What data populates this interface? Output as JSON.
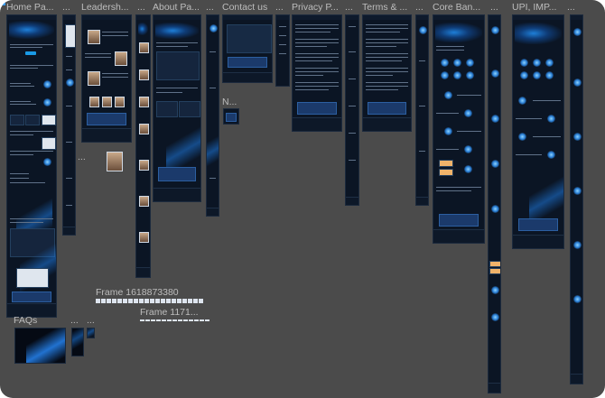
{
  "canvas": {
    "background": "#4b4b4b",
    "frame_color": "#0b1524",
    "accent": "#1a9ae6"
  },
  "frame_labels": {
    "home": "Home Pa...",
    "dots1": "...",
    "leadership": "Leadersh...",
    "dots2": "...",
    "about": "About Pa...",
    "dots3": "...",
    "contact": "Contact us",
    "dots4": "...",
    "privacy": "Privacy P...",
    "dots5": "...",
    "terms": "Terms & ...",
    "dots6": "...",
    "core": "Core Ban...",
    "dots7": "...",
    "upi": "UPI, IMP...",
    "dots8": "...",
    "n_frame": "N...",
    "dots_left": "...",
    "frame_1618": "Frame 1618873380",
    "frame_1171": "Frame 1171...",
    "faqs": "FAQs",
    "dots_faq1": "...",
    "dots_faq2": "..."
  }
}
